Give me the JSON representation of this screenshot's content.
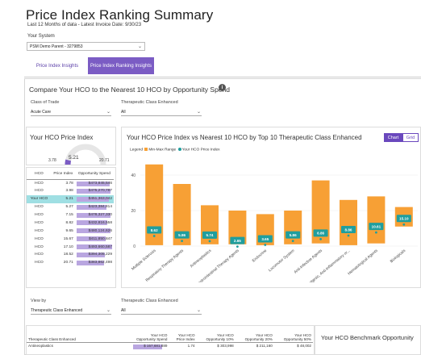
{
  "header": {
    "title": "Price Index Ranking Summary",
    "subtitle": "Last 12 Months of data - Latest Invoice Date: 9/30/23"
  },
  "system": {
    "label": "Your System",
    "value": "PSM Demo Parent - 3279853"
  },
  "tabs": [
    {
      "label": "Price Index Insights",
      "active": false
    },
    {
      "label": "Price Index Ranking Insights",
      "active": true
    }
  ],
  "compare": {
    "title": "Compare Your HCO to the Nearest 10 HCO by Opportunity Spend",
    "class_of_trade_label": "Class of Trade",
    "class_of_trade_value": "Acute Care",
    "therapeutic_label": "Therapeutic Class Enhanced",
    "therapeutic_value": "All"
  },
  "price_index_card": {
    "title": "Your HCO Price Index",
    "gauge_min": "3.78",
    "gauge_value": "5.21",
    "gauge_max": "20.71",
    "gauge_fraction": 0.08
  },
  "rank_table": {
    "headers": [
      "HCO",
      "Price Index",
      "Opportunity Spend"
    ],
    "rows": [
      {
        "hco": "HCO",
        "index": "3.78",
        "spend": "$473,845,546",
        "fill": 0.94
      },
      {
        "hco": "HCO",
        "index": "3.98",
        "spend": "$475,270,787",
        "fill": 0.95
      },
      {
        "hco": "Your HCO",
        "index": "5.21",
        "spend": "$451,363,042",
        "fill": 0.9,
        "highlight": true
      },
      {
        "hco": "HCO",
        "index": "5.27",
        "spend": "$423,384,814",
        "fill": 0.85
      },
      {
        "hco": "HCO",
        "index": "7.15",
        "spend": "$478,327,330",
        "fill": 0.96
      },
      {
        "hco": "HCO",
        "index": "8.82",
        "spend": "$432,816,558",
        "fill": 0.87
      },
      {
        "hco": "HCO",
        "index": "9.65",
        "spend": "$480,124,626",
        "fill": 0.96
      },
      {
        "hco": "HCO",
        "index": "15.67",
        "spend": "$411,850,847",
        "fill": 0.82
      },
      {
        "hco": "HCO",
        "index": "17.10",
        "spend": "$493,660,587",
        "fill": 0.99
      },
      {
        "hco": "HCO",
        "index": "18.52",
        "spend": "$394,305,229",
        "fill": 0.79
      },
      {
        "hco": "HCO",
        "index": "20.71",
        "spend": "$383,862,498",
        "fill": 0.77
      }
    ]
  },
  "chart_panel": {
    "title": "Your HCO Price Index vs Nearest 10 HCO by Top 10 Therapeutic Class Enhanced",
    "chart_button": "Chart",
    "grid_button": "Grid",
    "legend_prefix": "Legend",
    "legend_range": "Min-Max Range",
    "legend_hco": "Your HCO Price Index"
  },
  "colors": {
    "range_bar": "#f7a035",
    "hco_marker": "#1f9e9e",
    "accent": "#6a48bd",
    "highlight_row": "#9fdfe3"
  },
  "chart_data": {
    "type": "bar",
    "categories": [
      "Multiple Sclerosis",
      "Respiratory Therapy Agents",
      "Antineoplastics",
      "Gastrointestinal Therapy Agents",
      "Endocrine",
      "Locomotor System",
      "Anti-Infective Agents",
      "Analgesic, Anti-Inflammatory or...",
      "Hematological Agents",
      "Biologicals"
    ],
    "series": [
      {
        "name": "Min-Max Range",
        "values_min": [
          0.5,
          0.5,
          1,
          1,
          0.5,
          1,
          1.5,
          0.5,
          1.5,
          11
        ],
        "values_max": [
          46,
          35,
          23,
          20,
          18,
          20,
          37,
          26,
          28,
          22
        ]
      },
      {
        "name": "Your HCO Price Index",
        "values": [
          8.62,
          5.86,
          5.74,
          2.65,
          3.65,
          5.86,
          6.86,
          8.86,
          10.61,
          15.1
        ]
      }
    ],
    "value_labels": [
      "8.62",
      "5.86",
      "5.74",
      "2.65",
      "3.65",
      "5.86",
      "6.86",
      "8.86",
      "10.61",
      "15.10"
    ],
    "y_ticks": [
      "0",
      "20",
      "40"
    ],
    "ylim": [
      0,
      50
    ],
    "grid": true
  },
  "bottom_filters": {
    "view_by_label": "View by",
    "view_by_value": "Therapeutic Class Enhanced",
    "therapeutic_label": "Therapeutic Class Enhanced",
    "therapeutic_value": "All"
  },
  "bottom_table": {
    "headers": [
      "Therapeutic Class Enhanced",
      "Your HCO Opportunity Spend",
      "Your HCO Price Index",
      "Your HCO Opportunity 10%",
      "Your HCO Opportunity 20%",
      "Your HCO Opportunity 50%"
    ],
    "rows": [
      {
        "cls": "Antineoplastics",
        "spend": "$ 157,681,889",
        "index": "1.74",
        "o10": "$ 303,998",
        "o20": "$ 211,160",
        "o50": "$ 48,002",
        "fill": 0.9
      }
    ]
  },
  "benchmark": {
    "title": "Your HCO Benchmark Opportunity"
  }
}
